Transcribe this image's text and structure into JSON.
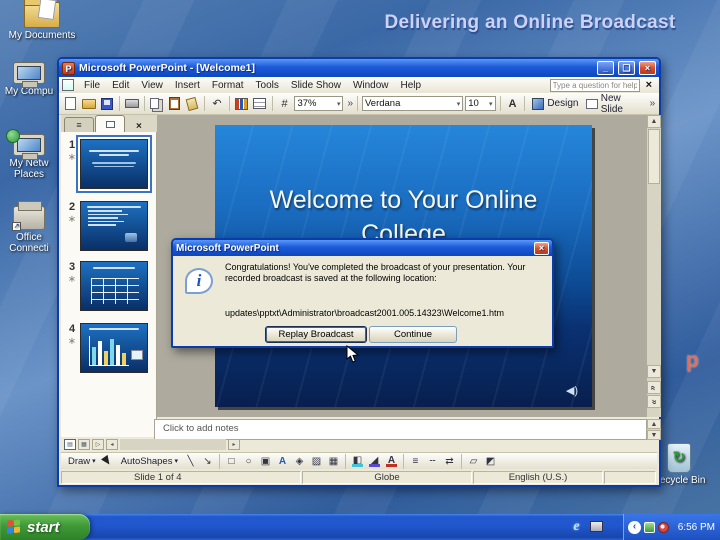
{
  "desktop": {
    "heading": "Delivering an Online Broadcast",
    "icons": {
      "my_documents": "My Documents",
      "my_computer": "My Compu",
      "my_network_line1": "My Netw",
      "my_network_line2": "Places",
      "office_line1": "Office",
      "office_line2": "Connecti",
      "recycle_bin": "Recycle Bin"
    },
    "stray_letter": "p"
  },
  "window": {
    "title": "Microsoft PowerPoint - [Welcome1]",
    "menu": [
      "File",
      "Edit",
      "View",
      "Insert",
      "Format",
      "Tools",
      "Slide Show",
      "Window",
      "Help"
    ],
    "help_placeholder": "Type a question for help",
    "toolbar": {
      "zoom": "37%",
      "font": "Verdana",
      "size": "10",
      "design": "Design",
      "new_slide": "New Slide",
      "icon_names": [
        "new",
        "open",
        "save",
        "print",
        "copy",
        "paste",
        "format-painter",
        "undo",
        "insert-chart",
        "insert-table",
        "show-grid"
      ]
    },
    "slides": [
      {
        "n": "1"
      },
      {
        "n": "2"
      },
      {
        "n": "3"
      },
      {
        "n": "4"
      }
    ],
    "slide": {
      "title_line1": "Welcome to Your Online",
      "title_line2": "College"
    },
    "notes_placeholder": "Click to add notes",
    "draw": {
      "draw": "Draw",
      "autoshapes": "AutoShapes",
      "icon_names": [
        "select-arrow",
        "line",
        "arrow",
        "rectangle",
        "oval",
        "text-box",
        "word-art",
        "diagram",
        "clip-art",
        "picture",
        "fill-color",
        "line-color",
        "font-color",
        "line-style",
        "dash-style",
        "arrow-style",
        "shadow",
        "3d"
      ]
    },
    "status": {
      "left": "Slide 1 of 4",
      "center": "Globe",
      "right": "English (U.S.)"
    }
  },
  "dialog": {
    "title": "Microsoft PowerPoint",
    "message": "Congratulations! You've completed the broadcast of your presentation. Your recorded broadcast is saved at the following location:",
    "path": "updates\\pptxt\\Administrator\\broadcast2001.005.14323\\Welcome1.htm",
    "replay": "Replay Broadcast",
    "continue": "Continue"
  },
  "taskbar": {
    "start": "start",
    "time": "6:56 PM"
  },
  "icons": {
    "close": "×",
    "minimize": "_",
    "restore": "❏",
    "combo_arrow": "▾",
    "more": "»",
    "undo": "↶",
    "grid": "#",
    "increase_font": "A",
    "outline_tab": "≡",
    "pp_letter": "P",
    "up": "▲",
    "down": "▼",
    "left": "◂",
    "right": "▸",
    "double": "«",
    "line": "╲",
    "arrow": "↘",
    "rect": "□",
    "oval": "○",
    "textbox": "▣",
    "wordart": "A",
    "diagram": "◈",
    "clipart": "▨",
    "picture": "▦",
    "fill_color": "◧",
    "line_color": "◢",
    "font_color": "A",
    "line_style": "≡",
    "dash_style": "╌",
    "arrow_style": "⇄",
    "shadow": "▱",
    "threed": "◩",
    "ie": "e",
    "tray_chevron": "‹",
    "star": "∗",
    "info": "i",
    "speaker": "◀)"
  }
}
